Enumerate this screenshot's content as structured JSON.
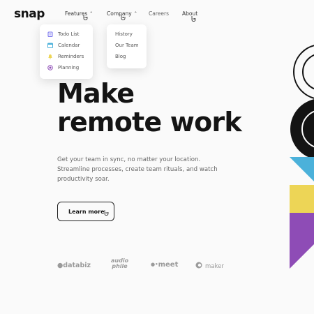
{
  "brand": {
    "logo": "snap"
  },
  "nav": {
    "features": {
      "label": "Features",
      "icon": "chevron-up-icon"
    },
    "company": {
      "label": "Company",
      "icon": "chevron-up-icon"
    },
    "careers": {
      "label": "Careers"
    },
    "about": {
      "label": "About"
    }
  },
  "features_menu": {
    "items": [
      {
        "label": "Todo List",
        "icon": "todo-list-icon",
        "color": "#726CEE"
      },
      {
        "label": "Calendar",
        "icon": "calendar-icon",
        "color": "#4BB1DA"
      },
      {
        "label": "Reminders",
        "icon": "reminders-icon",
        "color": "#EDD556"
      },
      {
        "label": "Planning",
        "icon": "planning-icon",
        "color": "#8E4CB6"
      }
    ]
  },
  "company_menu": {
    "items": [
      {
        "label": "History"
      },
      {
        "label": "Our Team"
      },
      {
        "label": "Blog"
      }
    ]
  },
  "hero": {
    "headline_line1": "Make",
    "headline_line2": "remote work",
    "description": "Get your team in sync, no matter your location. Streamline processes, create team rituals, and watch productivity soar.",
    "cta_label": "Learn more"
  },
  "clients": {
    "databiz": "databiz",
    "audiophile_top": "audio",
    "audiophile_bottom": "phile",
    "meet": "meet",
    "maker": "maker"
  },
  "colors": {
    "accent_blue": "#4BB1DA",
    "accent_yellow": "#EDD556",
    "accent_purple": "#8E4CB6",
    "ink": "#141414",
    "muted": "#666666",
    "background": "#FAFAFA"
  }
}
